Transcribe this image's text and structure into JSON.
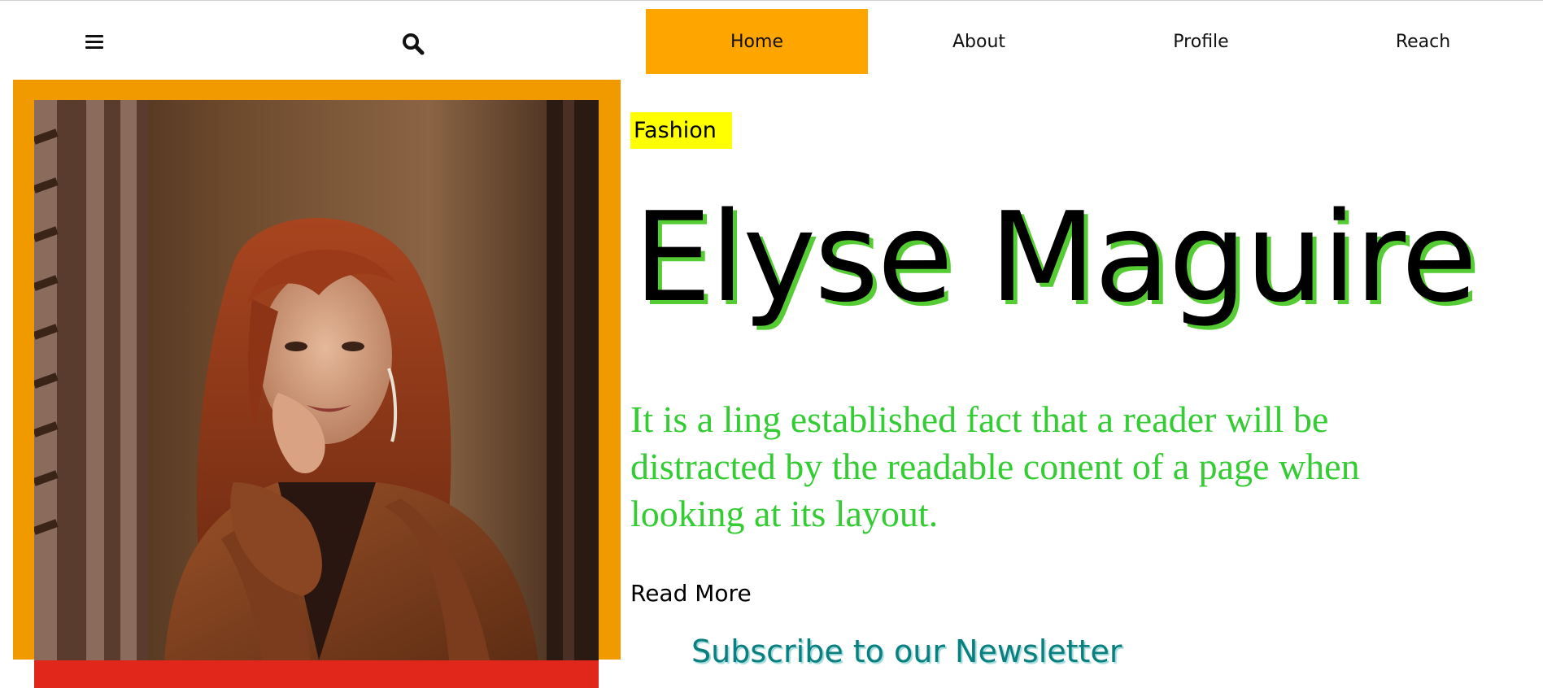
{
  "header": {
    "menu_icon": "menu-icon",
    "search_icon": "search-icon",
    "nav": [
      {
        "label": "Home",
        "active": true
      },
      {
        "label": "About",
        "active": false
      },
      {
        "label": "Profile",
        "active": false
      },
      {
        "label": "Reach",
        "active": false
      }
    ]
  },
  "hero": {
    "category": "Fashion",
    "title": "Elyse Maguire",
    "description": "It is a ling established fact that a reader will be distracted by the readable conent of a page when looking at its layout.",
    "read_more": "Read More",
    "newsletter": "Subscribe to our Newsletter"
  },
  "colors": {
    "nav_active": "#ffa500",
    "frame": "#f09a00",
    "frame_shadow": "#e1261c",
    "badge": "#ffff00",
    "title_shadow": "#55cc33",
    "description": "#33cc33",
    "newsletter": "#0a7f7f"
  }
}
